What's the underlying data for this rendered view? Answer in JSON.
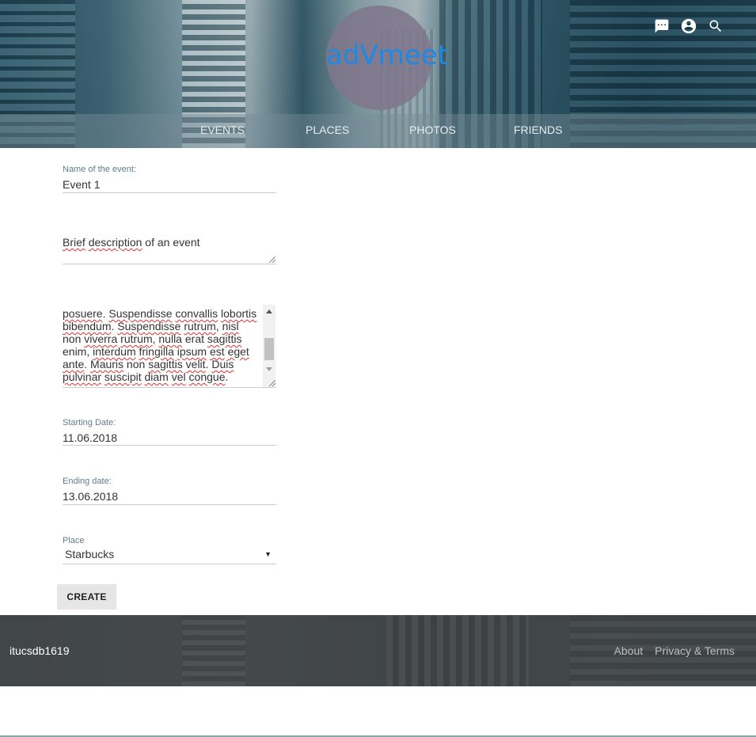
{
  "header": {
    "logo_text": "adVmeet",
    "icons": [
      "chat-icon",
      "account-icon",
      "search-icon"
    ]
  },
  "nav": {
    "items": [
      {
        "label": "EVENTS"
      },
      {
        "label": "PLACES"
      },
      {
        "label": "PHOTOS"
      },
      {
        "label": "FRIENDS"
      }
    ]
  },
  "form": {
    "name": {
      "label": "Name of the event:",
      "value": "Event 1"
    },
    "description": {
      "value_parts": [
        "Brief",
        "description",
        "of an event"
      ]
    },
    "details": {
      "lines": [
        [
          {
            "t": "posuere",
            "s": true
          },
          {
            "t": ". ",
            "s": false
          },
          {
            "t": "Suspendisse",
            "s": true
          },
          {
            "t": " ",
            "s": false
          },
          {
            "t": "convallis",
            "s": true
          },
          {
            "t": " ",
            "s": false
          },
          {
            "t": "lobortis",
            "s": true
          }
        ],
        [
          {
            "t": "bibendum",
            "s": true
          },
          {
            "t": ". ",
            "s": false
          },
          {
            "t": "Suspendisse",
            "s": true
          },
          {
            "t": " ",
            "s": false
          },
          {
            "t": "rutrum",
            "s": true
          },
          {
            "t": ", ",
            "s": false
          },
          {
            "t": "nisl",
            "s": true
          }
        ],
        [
          {
            "t": "non",
            "s": false
          },
          {
            "t": " ",
            "s": false
          },
          {
            "t": "viverra",
            "s": true
          },
          {
            "t": " ",
            "s": false
          },
          {
            "t": "rutrum",
            "s": true
          },
          {
            "t": ", ",
            "s": false
          },
          {
            "t": "nulla",
            "s": true
          },
          {
            "t": " erat ",
            "s": false
          },
          {
            "t": "sagittis",
            "s": true
          }
        ],
        [
          {
            "t": "enim",
            "s": false
          },
          {
            "t": ", ",
            "s": false
          },
          {
            "t": "interdum",
            "s": true
          },
          {
            "t": " ",
            "s": false
          },
          {
            "t": "fringilla",
            "s": true
          },
          {
            "t": " ",
            "s": false
          },
          {
            "t": "ipsum",
            "s": true
          },
          {
            "t": " ",
            "s": false
          },
          {
            "t": "est",
            "s": true
          },
          {
            "t": " ",
            "s": false
          },
          {
            "t": "eget",
            "s": true
          }
        ],
        [
          {
            "t": "ante",
            "s": true
          },
          {
            "t": ". ",
            "s": false
          },
          {
            "t": "Mauris",
            "s": true
          },
          {
            "t": " non ",
            "s": false
          },
          {
            "t": "sagittis",
            "s": true
          },
          {
            "t": " ",
            "s": false
          },
          {
            "t": "velit",
            "s": true
          },
          {
            "t": ". ",
            "s": false
          },
          {
            "t": "Duis",
            "s": true
          }
        ],
        [
          {
            "t": "pulvinar",
            "s": true
          },
          {
            "t": " ",
            "s": false
          },
          {
            "t": "suscipit",
            "s": true
          },
          {
            "t": " ",
            "s": false
          },
          {
            "t": "diam",
            "s": true
          },
          {
            "t": " ",
            "s": false
          },
          {
            "t": "vel",
            "s": true
          },
          {
            "t": " ",
            "s": false
          },
          {
            "t": "congue",
            "s": true
          },
          {
            "t": ".",
            "s": false
          }
        ]
      ]
    },
    "start_date": {
      "label": "Starting Date:",
      "value": "11.06.2018"
    },
    "end_date": {
      "label": "Ending date:",
      "value": "13.06.2018"
    },
    "place": {
      "label": "Place",
      "selected": "Starbucks"
    },
    "submit_label": "CREATE"
  },
  "footer": {
    "brand": "itucsdb1619",
    "links": [
      {
        "label": "About"
      },
      {
        "label": "Privacy & Terms"
      }
    ]
  },
  "colors": {
    "logo": "#1e88e5",
    "label": "#607d8b",
    "footer_bg": "#3c3e40"
  }
}
